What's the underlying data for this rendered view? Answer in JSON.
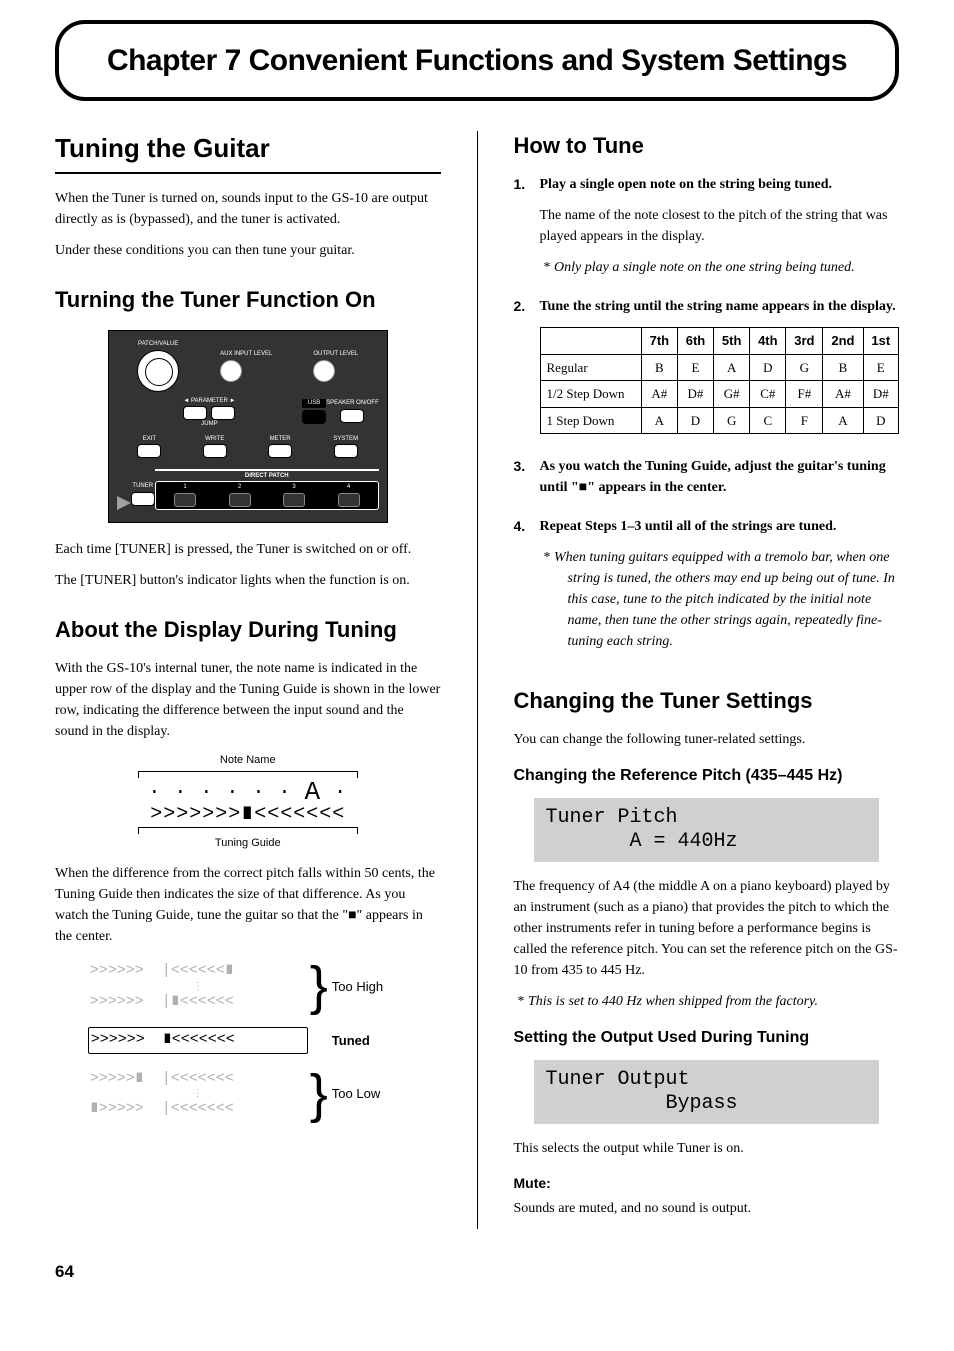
{
  "chapter_title": "Chapter 7 Convenient Functions and System Settings",
  "page_number": "64",
  "left": {
    "h1": "Tuning the Guitar",
    "intro1": "When the Tuner is turned on, sounds input to the GS-10 are output directly as is (bypassed), and the tuner is activated.",
    "intro2": "Under these conditions you can then tune your guitar.",
    "h2a": "Turning the Tuner Function On",
    "panel": {
      "label_patch_value": "PATCH/VALUE",
      "label_aux": "AUX INPUT LEVEL",
      "label_output": "OUTPUT LEVEL",
      "label_parameter": "◄ PARAMETER ►",
      "label_usb": "USB",
      "label_speaker": "SPEAKER ON/OFF",
      "label_jump": "JUMP",
      "label_exit": "EXIT",
      "label_write": "WRITE",
      "label_meter": "METER",
      "label_system": "SYSTEM",
      "label_tuner": "TUNER",
      "label_direct_patch": "DIRECT PATCH",
      "dp_nums": [
        "1",
        "2",
        "3",
        "4"
      ]
    },
    "p_tuner1": "Each time [TUNER] is pressed, the Tuner is switched on or off.",
    "p_tuner2": "The [TUNER] button's indicator lights when the function is on.",
    "h2b": "About the Display During Tuning",
    "p_display1": "With the GS-10's internal tuner, the note name is indicated in the upper row of the display and the Tuning Guide is shown in the lower row, indicating the difference between the input sound and the sound in the display.",
    "noteguide": {
      "label_note": "Note Name",
      "label_guide": "Tuning Guide",
      "arrows": ">>>>>>>∎<<<<<<<"
    },
    "p_display2": "When the difference from the correct pitch falls within 50 cents, the Tuning Guide then indicates the size of that difference. As you watch the Tuning Guide, tune the guitar so that the \"■\" appears in the center.",
    "pitchfig": {
      "high1": ">>>>>>  |<<<<<<∎",
      "high2": ">>>>>>  |∎<<<<<<",
      "tuned": ">>>>>>  ∎<<<<<<<",
      "low1": ">>>>>∎  |<<<<<<<",
      "low2": "∎>>>>>  |<<<<<<<",
      "label_high": "Too High",
      "label_tuned": "Tuned",
      "label_low": "Too Low"
    }
  },
  "right": {
    "h2a": "How to Tune",
    "step1_bold": "Play a single open note on the string being tuned.",
    "step1_body": "The name of the note closest to the pitch of the string that was played appears in the display.",
    "step1_note": "Only play a single note on the one string being tuned.",
    "step2_bold": "Tune the string until the string name appears in the display.",
    "table": {
      "headers": [
        "",
        "7th",
        "6th",
        "5th",
        "4th",
        "3rd",
        "2nd",
        "1st"
      ],
      "rows": [
        [
          "Regular",
          "B",
          "E",
          "A",
          "D",
          "G",
          "B",
          "E"
        ],
        [
          "1/2 Step Down",
          "A#",
          "D#",
          "G#",
          "C#",
          "F#",
          "A#",
          "D#"
        ],
        [
          "1 Step Down",
          "A",
          "D",
          "G",
          "C",
          "F",
          "A",
          "D"
        ]
      ]
    },
    "step3_bold": "As you watch the Tuning Guide, adjust the guitar's tuning until \"■\" appears in the center.",
    "step4_bold": "Repeat Steps 1–3 until all of the strings are tuned.",
    "step4_note": "When tuning guitars equipped with a tremolo bar, when one string is tuned, the others may end up being out of tune. In this case, tune to the pitch indicated by the initial note name, then tune the other strings again, repeatedly fine-tuning each string.",
    "h2b": "Changing the Tuner Settings",
    "p_change_intro": "You can change the following tuner-related settings.",
    "h3a": "Changing the Reference Pitch (435–445 Hz)",
    "lcd1_l1": "Tuner Pitch",
    "lcd1_l2": "       A = 440Hz",
    "p_refpitch": "The frequency of A4 (the middle A on a piano keyboard) played by an instrument (such as a piano) that provides the pitch to which the other instruments refer in tuning before a performance begins is called the reference pitch. You can set the reference pitch on the GS-10 from 435 to 445 Hz.",
    "p_refpitch_note": "This is set to 440 Hz when shipped from the factory.",
    "h3b": "Setting the Output Used During Tuning",
    "lcd2_l1": "Tuner Output",
    "lcd2_l2": "          Bypass",
    "p_output": "This selects the output while Tuner is on.",
    "h4_mute": "Mute:",
    "p_mute": "Sounds are muted, and no sound is output."
  }
}
